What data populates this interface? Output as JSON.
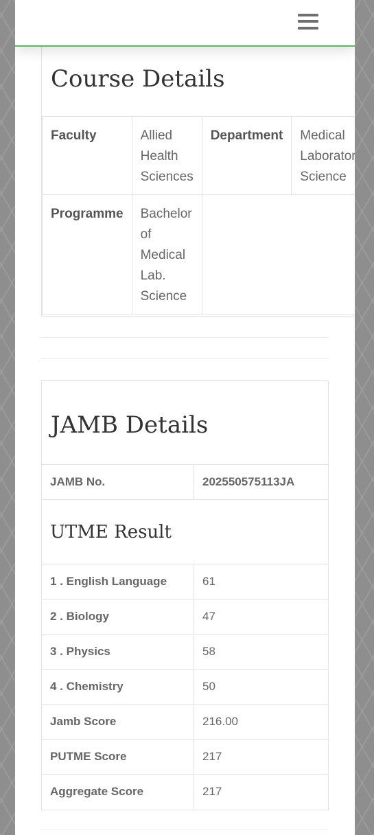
{
  "header": {
    "menu_icon": "hamburger-menu-icon"
  },
  "course": {
    "title": "Course Details",
    "faculty_label": "Faculty",
    "faculty_value": "Allied Health Sciences",
    "department_label": "Department",
    "department_value": "Medical Laboratory Science",
    "programme_label": "Programme",
    "programme_value": "Bachelor of Medical Lab. Science"
  },
  "jamb": {
    "title": "JAMB Details",
    "jamb_no_label": "JAMB No.",
    "jamb_no_value": "202550575113JA",
    "utme_title": "UTME Result",
    "subjects": [
      {
        "label": "1 . English Language",
        "score": "61"
      },
      {
        "label": "2 . Biology",
        "score": "47"
      },
      {
        "label": "3 . Physics",
        "score": "58"
      },
      {
        "label": "4 . Chemistry",
        "score": "50"
      }
    ],
    "jamb_score_label": "Jamb Score",
    "jamb_score_value": "216.00",
    "putme_label": "PUTME Score",
    "putme_value": "217",
    "aggregate_label": "Aggregate Score",
    "aggregate_value": "217"
  },
  "colors": {
    "accent": "#5cb85c",
    "border": "#e2e2e2",
    "backdrop": "#8e8e8e"
  }
}
